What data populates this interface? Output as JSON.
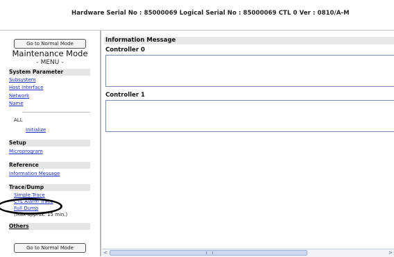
{
  "header": {
    "serial_line": "Hardware Serial No : 85000069  Logical Serial No : 85000069  CTL 0  Ver : 0810/A-M"
  },
  "sidebar": {
    "top_button": "Go to Normal Mode",
    "title": "Maintenance Mode",
    "subtitle": "- MENU -",
    "system_parameter": {
      "heading": "System Parameter",
      "items": [
        "Subsystem",
        "Host Interface",
        "Network",
        "Name"
      ]
    },
    "all_label": "ALL",
    "initialize": "Initialize",
    "setup": {
      "heading": "Setup",
      "items": [
        "Microprogram"
      ]
    },
    "reference": {
      "heading": "Reference",
      "items": [
        "Information Message"
      ]
    },
    "trace_dump": {
      "heading": "Trace/Dump",
      "items": [
        "Simple Trace",
        "CTL Alarm Trace",
        "Full Dump"
      ],
      "note": "(Max approx. 15 min.)"
    },
    "others": {
      "heading": "Others"
    },
    "bottom_button": "Go to Normal Mode"
  },
  "main": {
    "heading": "Information Message",
    "controller0_label": "Controller 0",
    "controller1_label": "Controller 1",
    "controller0_text": "",
    "controller1_text": ""
  },
  "scrollbar": {
    "left_arrow": "<",
    "right_arrow": ">"
  },
  "annotation": {
    "highlight_color": "#000000"
  },
  "colors": {
    "link": "#1a2fc7",
    "section_bg": "#e6e6e6"
  }
}
